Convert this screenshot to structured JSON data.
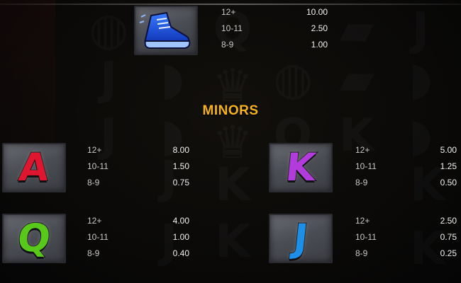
{
  "top_symbol": {
    "icon": "blue-sneaker-icon",
    "rows": [
      {
        "count": "12+",
        "value": "10.00"
      },
      {
        "count": "10-11",
        "value": "2.50"
      },
      {
        "count": "8-9",
        "value": "1.00"
      }
    ]
  },
  "section_title": "MINORS",
  "minors": [
    {
      "letter": "A",
      "icon": "letter-a-icon",
      "color": "#e0152f",
      "rows": [
        {
          "count": "12+",
          "value": "8.00"
        },
        {
          "count": "10-11",
          "value": "1.50"
        },
        {
          "count": "8-9",
          "value": "0.75"
        }
      ]
    },
    {
      "letter": "K",
      "icon": "letter-k-icon",
      "color": "#b23bdc",
      "rows": [
        {
          "count": "12+",
          "value": "5.00"
        },
        {
          "count": "10-11",
          "value": "1.25"
        },
        {
          "count": "8-9",
          "value": "0.50"
        }
      ]
    },
    {
      "letter": "Q",
      "icon": "letter-q-icon",
      "color": "#58c81b",
      "rows": [
        {
          "count": "12+",
          "value": "4.00"
        },
        {
          "count": "10-11",
          "value": "1.00"
        },
        {
          "count": "8-9",
          "value": "0.40"
        }
      ]
    },
    {
      "letter": "J",
      "icon": "letter-j-icon",
      "color": "#1e8fe8",
      "rows": [
        {
          "count": "12+",
          "value": "2.50"
        },
        {
          "count": "10-11",
          "value": "0.75"
        },
        {
          "count": "8-9",
          "value": "0.25"
        }
      ]
    }
  ],
  "colors": {
    "accent": "#f6b31a",
    "background": "#0b0b0c"
  }
}
